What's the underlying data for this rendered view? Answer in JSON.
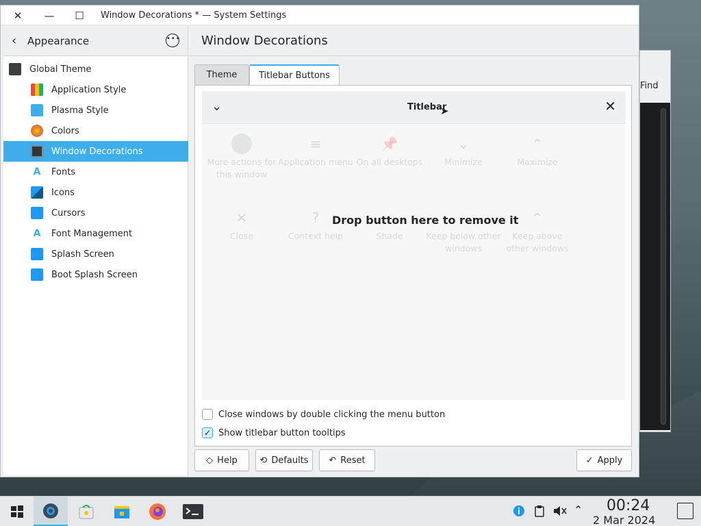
{
  "window": {
    "title": "Window Decorations * — System Settings",
    "controls": {
      "close": "✕",
      "minimize": "—",
      "maximize": "☐"
    }
  },
  "sidebar": {
    "back_icon": "‹",
    "header": "Appearance",
    "more_icon": "•••",
    "items": [
      {
        "label": "Global Theme",
        "icon": "global-theme-icon",
        "color": "#3b3f42"
      },
      {
        "label": "Application Style",
        "icon": "application-style-icon",
        "color": "#e74c3c"
      },
      {
        "label": "Plasma Style",
        "icon": "plasma-style-icon",
        "color": "#3daee9"
      },
      {
        "label": "Colors",
        "icon": "colors-icon",
        "color": "#e67e22"
      },
      {
        "label": "Window Decorations",
        "icon": "window-decorations-icon",
        "color": "#31363b",
        "selected": true
      },
      {
        "label": "Fonts",
        "icon": "fonts-icon",
        "color": "#3daee9"
      },
      {
        "label": "Icons",
        "icon": "icons-icon",
        "color": "#1d99f3"
      },
      {
        "label": "Cursors",
        "icon": "cursors-icon",
        "color": "#1d99f3"
      },
      {
        "label": "Font Management",
        "icon": "font-management-icon",
        "color": "#3daee9"
      },
      {
        "label": "Splash Screen",
        "icon": "splash-screen-icon",
        "color": "#1d99f3"
      },
      {
        "label": "Boot Splash Screen",
        "icon": "boot-splash-screen-icon",
        "color": "#1d99f3"
      }
    ]
  },
  "content": {
    "title": "Window Decorations",
    "tabs": [
      {
        "label": "Theme",
        "active": false
      },
      {
        "label": "Titlebar Buttons",
        "active": true
      }
    ],
    "preview": {
      "title": "Titlebar",
      "left_icon": "chevron-down-icon",
      "right_icon": "close-icon"
    },
    "available_buttons": [
      {
        "label": "More actions for this window",
        "glyph": ""
      },
      {
        "label": "Application menu",
        "glyph": "≡"
      },
      {
        "label": "On all desktops",
        "glyph": "📌"
      },
      {
        "label": "Minimize",
        "glyph": "⌄"
      },
      {
        "label": "Maximize",
        "glyph": "⌃"
      },
      {
        "label": "Close",
        "glyph": "✕"
      },
      {
        "label": "Context help",
        "glyph": "?"
      },
      {
        "label": "Shade",
        "glyph": ""
      },
      {
        "label": "Keep below other windows",
        "glyph": ""
      },
      {
        "label": "Keep above other windows",
        "glyph": "⌃"
      }
    ],
    "drop_hint": "Drop button here to remove it",
    "options": [
      {
        "label": "Close windows by double clicking the menu button",
        "checked": false
      },
      {
        "label": "Show titlebar button tooltips",
        "checked": true
      }
    ]
  },
  "footer": {
    "help": "Help",
    "defaults": "Defaults",
    "reset": "Reset",
    "apply": "Apply"
  },
  "background_window": {
    "find_label": "Find"
  },
  "taskbar": {
    "time": "00:24",
    "date": "2 Mar 2024"
  },
  "colors": {
    "accent": "#3daee9",
    "selection": "#3daee9"
  }
}
